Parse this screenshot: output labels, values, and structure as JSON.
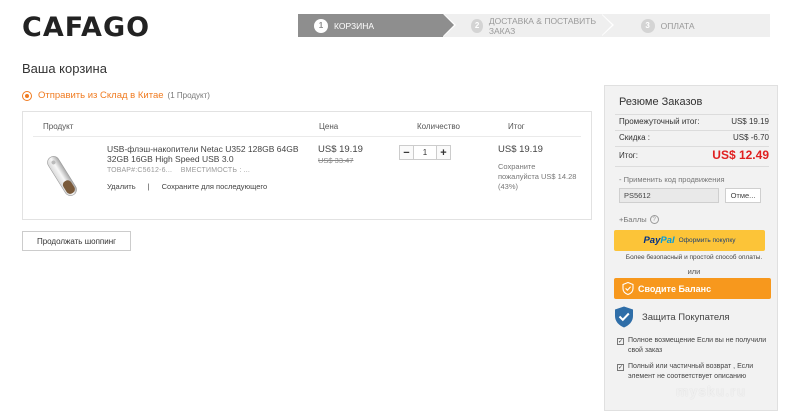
{
  "brand": {
    "logo_text": "CAFAGO"
  },
  "steps": [
    {
      "num": "1",
      "label": "КОРЗИНА",
      "active": true
    },
    {
      "num": "2",
      "label": "ДОСТАВКА & ПОСТАВИТЬ ЗАКАЗ",
      "active": false
    },
    {
      "num": "3",
      "label": "ОПЛАТА",
      "active": false
    }
  ],
  "cart": {
    "title": "Ваша корзина",
    "ship_from": "Отправить из Склад в Китае",
    "ship_count": "(1 Продукт)",
    "headers": {
      "product": "Продукт",
      "price": "Цена",
      "quantity": "Количество",
      "total": "Итог"
    },
    "item": {
      "name": "USB-флэш-накопители Netac U352 128GB 64GB 32GB 16GB High Speed USB 3.0",
      "sku": "ТОВАР#:C5612-6...",
      "capacity": "ВМЕСТИМОСТЬ : ...",
      "remove": "Удалить",
      "separator": "|",
      "save_later": "Сохраните для последующего",
      "price_now": "US$ 19.19",
      "price_old": "US$ 33.47",
      "qty_minus": "−",
      "qty_value": "1",
      "qty_plus": "+",
      "total": "US$ 19.19",
      "save_text": "Сохраните пожалуйста US$ 14.28 (43%)"
    },
    "continue_label": "Продолжать шоппинг"
  },
  "summary": {
    "title": "Резюме Заказов",
    "subtotal_label": "Промежуточный итог:",
    "subtotal_value": "US$ 19.19",
    "discount_label": "Скидка :",
    "discount_value": "US$ -6.70",
    "total_label": "Итог:",
    "total_value": "US$  12.49",
    "promo_label": "- Применить код продвижения",
    "promo_value": "PS5612",
    "promo_button": "Отме...",
    "points_label": "+Баллы",
    "help_glyph": "?",
    "paypal_brand_a": "Pay",
    "paypal_brand_b": "Pal",
    "paypal_label": "Оформить покупку",
    "paypal_note": "Более безопасный и простой способ оплаты.",
    "or": "или",
    "balance_label": "Сводите Баланс",
    "protection_title": "Защита Покупателя",
    "checks": [
      "Полное возмещение Если вы не получили свой заказ",
      "Полный или частичный возврат , Если элемент не соответствует описанию"
    ]
  },
  "watermark": "mysku.ru",
  "colors": {
    "accent": "#f07b20",
    "price_red": "#e02020",
    "paypal_yellow": "#fcc438",
    "balance_orange": "#f7981d",
    "step_active": "#8e8e8e"
  }
}
